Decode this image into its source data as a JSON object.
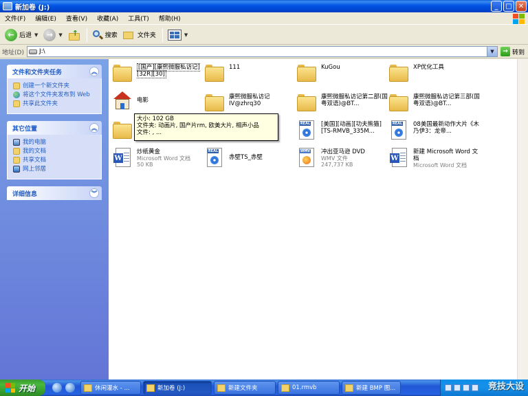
{
  "window": {
    "title": "新加卷 (J:)"
  },
  "menu": [
    "文件(F)",
    "编辑(E)",
    "查看(V)",
    "收藏(A)",
    "工具(T)",
    "帮助(H)"
  ],
  "toolbar": {
    "back": "后退",
    "search": "搜索",
    "folders": "文件夹"
  },
  "address": {
    "label": "地址(D)",
    "value": "J:\\",
    "go": "转到"
  },
  "left": {
    "tasks": {
      "title": "文件和文件夹任务",
      "links": [
        "创建一个新文件夹",
        "将这个文件夹发布到 Web",
        "共享此文件夹"
      ]
    },
    "places": {
      "title": "其它位置",
      "links": [
        "我的电脑",
        "我的文档",
        "共享文档",
        "网上邻居"
      ]
    },
    "details": {
      "title": "详细信息"
    }
  },
  "files": [
    {
      "name": "[国产][康熙微服私访记][32R][30]",
      "sub1": "",
      "sub2": "",
      "type": "folder"
    },
    {
      "name": "111",
      "sub1": "",
      "sub2": "",
      "type": "folder"
    },
    {
      "name": "KuGou",
      "sub1": "",
      "sub2": "",
      "type": "folder"
    },
    {
      "name": "XP优化工具",
      "sub1": "",
      "sub2": "",
      "type": "folder"
    },
    {
      "name": "电影",
      "sub1": "",
      "sub2": "",
      "type": "house"
    },
    {
      "name": "康熙微服私访记IV@zhrq30",
      "sub1": "",
      "sub2": "",
      "type": "folder"
    },
    {
      "name": "康熙微服私访记第二部(国粤双语)@BT...",
      "sub1": "",
      "sub2": "",
      "type": "folder"
    },
    {
      "name": "康熙微服私访记第三部(国粤双语)@BT...",
      "sub1": "",
      "sub2": "",
      "type": "folder"
    },
    {
      "name": "",
      "sub1": "",
      "sub2": "",
      "type": "folder"
    },
    {
      "name": "",
      "sub1": "",
      "sub2": "",
      "type": "none"
    },
    {
      "name": "[美国][动画][功夫熊猫][TS-RMVB_335M...",
      "sub1": "",
      "sub2": "",
      "type": "real"
    },
    {
      "name": "08美国最新动作大片《木乃伊3：龙帝...",
      "sub1": "",
      "sub2": "",
      "type": "real"
    },
    {
      "name": "炒纸黄金",
      "sub1": "Microsoft Word 文档",
      "sub2": "50 KB",
      "type": "word"
    },
    {
      "name": "赤壁TS_赤壁",
      "sub1": "",
      "sub2": "",
      "type": "real"
    },
    {
      "name": "冲出亚马逊 DVD",
      "sub1": "WMV 文件",
      "sub2": "247,737 KB",
      "type": "wmv"
    },
    {
      "name": "新建 Microsoft Word 文档",
      "sub1": "Microsoft Word 文档",
      "sub2": "",
      "type": "word"
    }
  ],
  "tooltip": {
    "line1": "大小: 102 GB",
    "line2": "文件夹: 动画片, 国产片rm, 欧美大片, 相声小品",
    "line3": "文件: , ..."
  },
  "taskbar": {
    "start": "开始",
    "tasks": [
      "休闲灌水 - ...",
      "新加卷 (J:)",
      "新建文件夹",
      "01.rmvb",
      "新建 BMP 图..."
    ]
  },
  "watermark": "竞技大设"
}
